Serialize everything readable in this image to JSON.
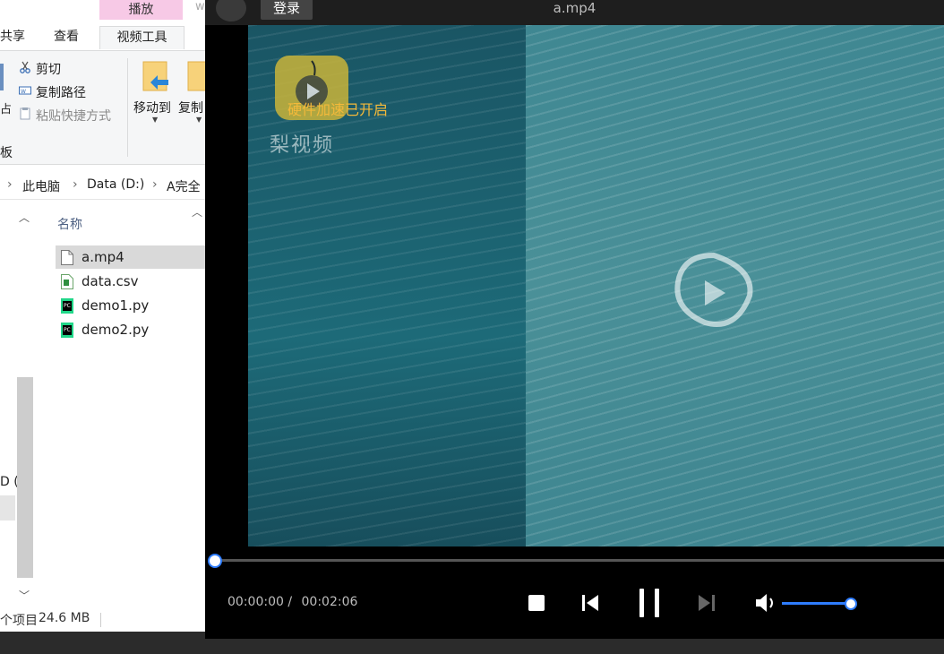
{
  "explorer": {
    "ribbon": {
      "context_header": "播放",
      "tabs": [
        "共享",
        "查看",
        "视频工具"
      ],
      "faded_tab": "w",
      "clipboard": {
        "cut": "剪切",
        "copy_path": "复制路径",
        "paste_shortcut": "粘贴快捷方式",
        "group_label_partial": "板"
      },
      "organize": {
        "move_to": "移动到",
        "copy_to_partial": "复制"
      }
    },
    "address_bar": {
      "crumbs": [
        "此电脑",
        "Data (D:)",
        "A完全"
      ]
    },
    "file_list": {
      "column_header": "名称",
      "files": [
        {
          "name": "a.mp4",
          "type": "video"
        },
        {
          "name": "data.csv",
          "type": "csv"
        },
        {
          "name": "demo1.py",
          "type": "python"
        },
        {
          "name": "demo2.py",
          "type": "python"
        }
      ]
    },
    "nav_partial_label": "D (",
    "status_bar": {
      "items_partial": "个项目",
      "size": "24.6 MB"
    }
  },
  "player": {
    "login_label": "登录",
    "title": "a.mp4",
    "overlay_text": "硬件加速已开启",
    "watermark_text": "梨视频",
    "time_current": "00:00:00 /",
    "time_total": "00:02:06",
    "progress": 0,
    "volume": 1.0,
    "controls": [
      "stop-icon",
      "previous-icon",
      "pause-icon",
      "next-icon",
      "volume-icon"
    ],
    "accent_color": "#2f7dff"
  }
}
